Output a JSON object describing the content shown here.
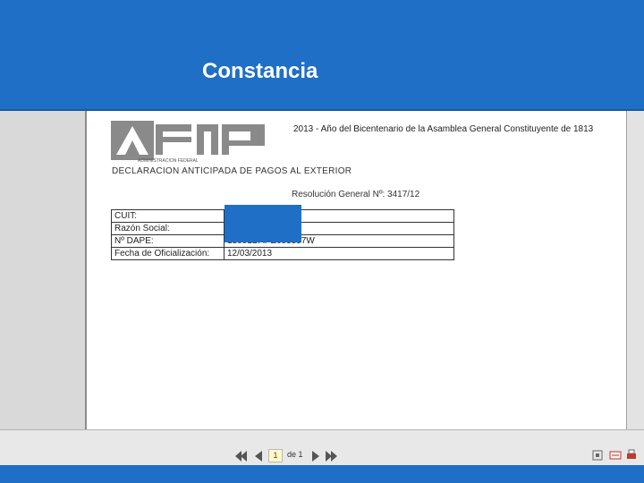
{
  "header": {
    "title": "Constancia"
  },
  "document": {
    "logo_text": "ADMINISTRACION FEDERAL",
    "year_text": "2013 - Año del Bicentenario de la Asamblea General Constituyente de 1813",
    "declaration_title": "DECLARACION ANTICIPADA DE PAGOS AL EXTERIOR",
    "resolution": "Resolución General Nº: 3417/12",
    "rows": [
      {
        "label": "CUIT:",
        "value": ""
      },
      {
        "label": "Razón Social:",
        "value": ""
      },
      {
        "label": "Nº DAPE:",
        "value": "13001DAPE693557W"
      },
      {
        "label": "Fecha de Oficialización:",
        "value": "12/03/2013"
      }
    ]
  },
  "viewer": {
    "current_page": "1",
    "of_label": "de",
    "total_pages": "1"
  },
  "colors": {
    "header_blue": "#1f6fc6",
    "panel_gray": "#d9d9d9"
  }
}
